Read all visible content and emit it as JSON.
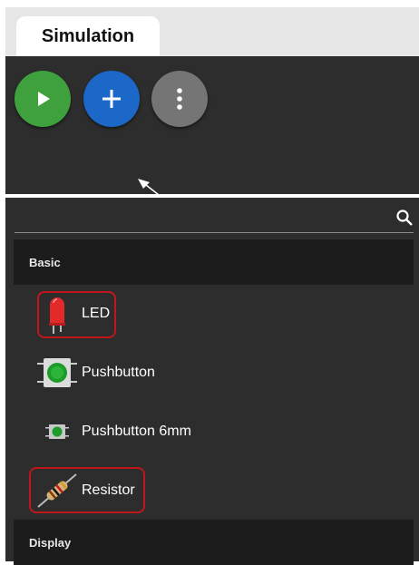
{
  "tabs": [
    {
      "label": "Simulation"
    }
  ],
  "toolbar": {
    "play_icon": "play-icon",
    "add_icon": "plus-icon",
    "more_icon": "more-vertical-icon"
  },
  "search": {
    "value": "",
    "icon": "search-icon"
  },
  "library": {
    "categories": [
      {
        "label": "Basic"
      },
      {
        "label": "Display"
      }
    ],
    "items": [
      {
        "label": "LED",
        "icon": "led-icon"
      },
      {
        "label": "Pushbutton",
        "icon": "pushbutton-icon"
      },
      {
        "label": "Pushbutton 6mm",
        "icon": "pushbutton-6mm-icon"
      },
      {
        "label": "Resistor",
        "icon": "resistor-icon"
      }
    ]
  },
  "colors": {
    "play": "#3fa13e",
    "add": "#1b68c9",
    "more": "#757575",
    "panel": "#2d2d2d",
    "highlight": "#c0171c"
  }
}
